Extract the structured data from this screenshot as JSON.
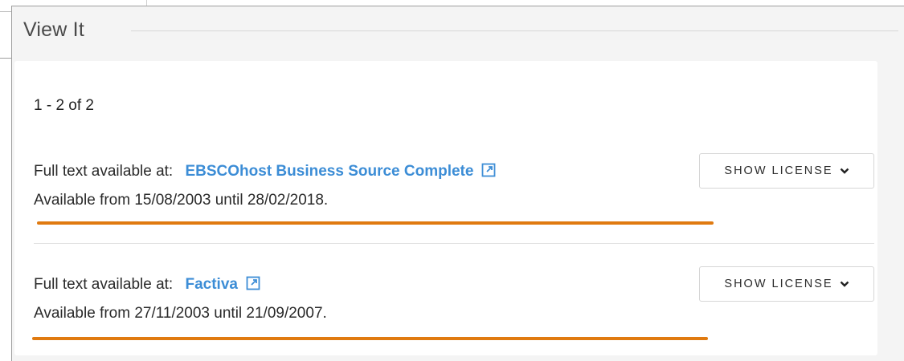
{
  "panel": {
    "title": "View It"
  },
  "results": {
    "count_text": "1 - 2 of 2",
    "items": [
      {
        "label": "Full text available at:",
        "source": "EBSCOhost Business Source Complete",
        "availability": "Available from 15/08/2003 until 28/02/2018.",
        "license_button": "SHOW LICENSE"
      },
      {
        "label": "Full text available at:",
        "source": "Factiva",
        "availability": "Available from 27/11/2003 until 21/09/2007.",
        "license_button": "SHOW LICENSE"
      }
    ]
  },
  "icons": {
    "external_link": "external-link-icon",
    "chevron": "chevron-down-icon"
  },
  "colors": {
    "link": "#3c8dd6",
    "highlight_underline": "#e07a10",
    "panel_background": "#f4f4f4",
    "card_background": "#ffffff"
  }
}
